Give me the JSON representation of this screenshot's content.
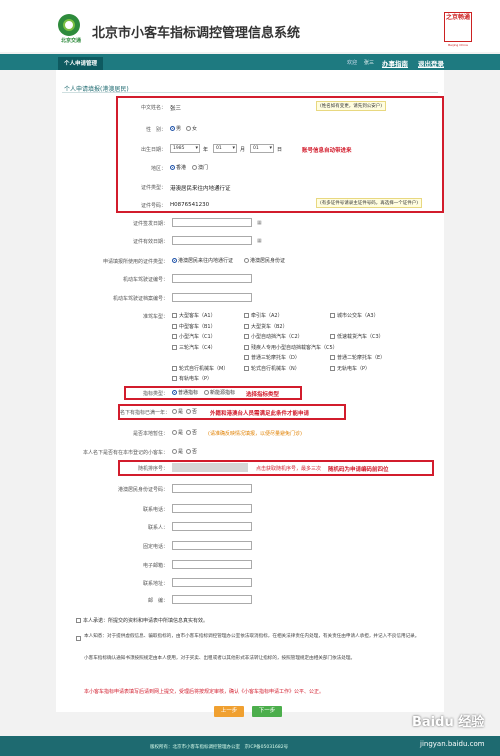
{
  "header": {
    "logo_text": "北京交通",
    "title": "北京市小客车指标调控管理信息系统",
    "stamp_text": "之京畅通",
    "stamp_sub": "Beijing China"
  },
  "nav": {
    "tab": "个人申请管理",
    "welcome": "欢迎",
    "user": "张三",
    "guide": "办事指南",
    "logout": "退出登录"
  },
  "section": {
    "title": "个人申请填报(港澳居民)"
  },
  "personal": {
    "name_label": "中文姓名：",
    "name_value": "张三",
    "name_hint": "(姓名如有变更，请先到公安户)",
    "gender_label": "性　别：",
    "gender_male": "男",
    "gender_female": "女",
    "birth_label": "出生日期：",
    "birth_year": "1985",
    "year_unit": "年",
    "birth_month": "01",
    "month_unit": "月",
    "birth_day": "01",
    "day_unit": "日",
    "region_label": "地区：",
    "region_hk": "香港",
    "region_mo": "澳门",
    "doc_type_label": "证件类型：",
    "doc_type_value": "港澳居民来往内地通行证",
    "doc_no_label": "证件号码：",
    "doc_no_value": "H0876541230",
    "doc_no_hint": "(有多证件号请录主证件号码，再选择一个证件户)",
    "auto_note": "账号信息自动带进来"
  },
  "form": {
    "issue_date_label": "证件签发日期：",
    "valid_date_label": "证件有效日期：",
    "apply_doc_label": "申请填报所使用的证件类型：",
    "apply_doc_opt1": "港澳居民来往内地通行证",
    "apply_doc_opt2": "港澳居民身份证",
    "vehicle_label": "机动车驾驶证编号：",
    "archive_label": "机动车驾驶证档案编号：",
    "license_type_label": "准驾车型：",
    "license_types": [
      [
        "大型客车（A1）",
        "牵引车（A2）",
        "城市公交车（A3）"
      ],
      [
        "中型客车（B1）",
        "大型货车（B2）",
        ""
      ],
      [
        "小型汽车（C1）",
        "小型自动挡汽车（C2）",
        "低速载货汽车（C3）"
      ],
      [
        "三轮汽车（C4）",
        "残疾人专用小型自动挡载客汽车（C5）",
        ""
      ],
      [
        "",
        "普通三轮摩托车（D）",
        "普通二轮摩托车（E）"
      ],
      [
        "轮式自行机械车（M）",
        "轮式自行机械车（N）",
        "无轨电车（P）"
      ],
      [
        "有轨电车（P）",
        "",
        ""
      ]
    ],
    "quota_type_label": "指标类型：",
    "quota_opt1": "普通指标",
    "quota_opt2": "新能源指标",
    "quota_note": "选择指标类型",
    "expired_label": "名下有指标已满一年：",
    "expired_yes": "是",
    "expired_no": "否",
    "expired_note": "外籍和港澳台人员需满足此条件才能申请",
    "agent_label": "是否本地暂住：",
    "agent_yes": "是",
    "agent_no": "否",
    "agent_warn": "(请准确反映情况填报，以便尽量避免门诊)",
    "local_label": "本人名下是否有在本市登记的小客车：",
    "local_yes": "是",
    "local_no": "否",
    "serial_label": "随机排序号：",
    "serial_warn": "点击获取随机序号，最多三次",
    "serial_note": "随机码为申请编码前四位",
    "postal_label": "港澳居民身份证号码：",
    "phone_label": "联系电话：",
    "contact_label": "联系人：",
    "fixed_label": "固定电话：",
    "mobile_label": "电子邮箱：",
    "address_label": "联系地址：",
    "zip_label": "邮　编："
  },
  "agreement": {
    "check1": "本人承诺：所提交的资料和申请表中所填信息真实有效。",
    "para1": "本人知悉：对于提供虚假信息、骗取指标的，由市小客车指标调控管理办公室依法取消指标，在相关法律责任内处理，有关责任由申请人承担，并记入不良信用记录。",
    "para2": "小客车指标确认通知书须按照规定由本人使用，对于买卖、出租或者以其他形式非法转让指标的，按照管理规定由相关部门依法处理。",
    "redline": "本小客车指标申请表填写后请到网上提交，受理后将按规定审核，确认《小客车指标申请工作》公平、公正。"
  },
  "buttons": {
    "prev": "上一步",
    "next": "下一步"
  },
  "footer": {
    "text": "版权所有：北京市小客车指标调控管理办公室　京ICP备05031682号",
    "watermark": "Baidu 经验",
    "watermark_url": "jingyan.baidu.com"
  }
}
